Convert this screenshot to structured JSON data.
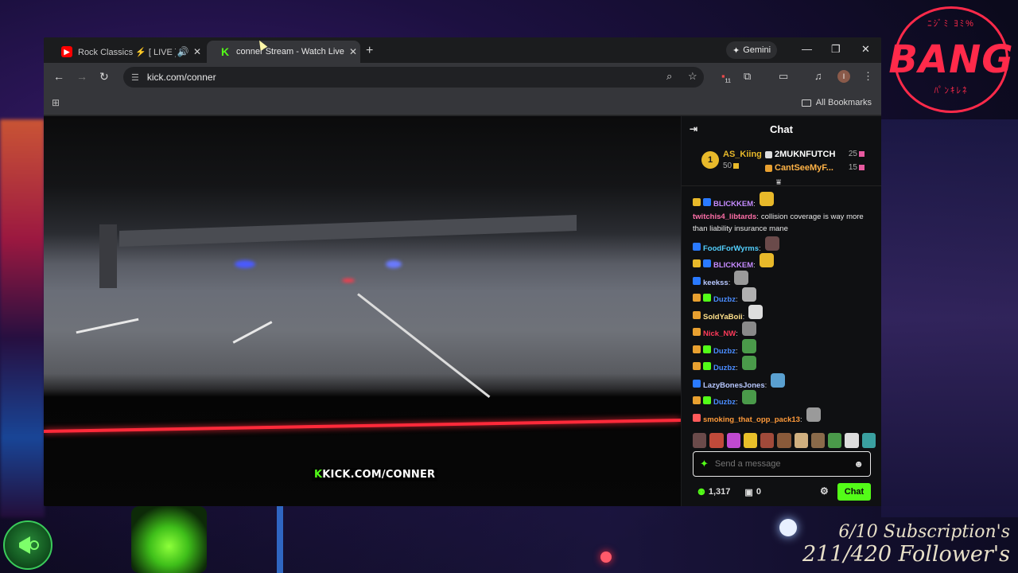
{
  "overlay": {
    "logo_text": "BANG",
    "logo_ring_top": "ﾆｼﾞﾐ ﾖﾐ%",
    "logo_ring_bottom": "ﾊﾟﾝｷﾚﾈ",
    "subscriptions": "6/10 Subscription's",
    "followers": "211/420 Follower's"
  },
  "browser": {
    "tabs": [
      {
        "title": "Rock Classics ⚡ [ LIVE ] Tim",
        "icon": "youtube-icon",
        "active": false
      },
      {
        "title": "conner Stream - Watch Live on",
        "icon": "kick-icon",
        "active": true
      }
    ],
    "gemini_label": "Gemini",
    "url": "kick.com/conner",
    "extensions_badge": "11",
    "profile_initial": "I",
    "all_bookmarks": "All Bookmarks"
  },
  "video": {
    "watermark_k": "K",
    "watermark_text": "KICK.COM/CONNER"
  },
  "chat": {
    "title": "Chat",
    "leaderboard": {
      "rank": "1",
      "top_name": "AS_Kiing",
      "top_count": "50",
      "rows": [
        {
          "name": "2MUKNFUTCH",
          "count": "25",
          "color": "#ffffff"
        },
        {
          "name": "CantSeeMyF...",
          "count": "15",
          "color": "#ffb347"
        }
      ]
    },
    "messages": [
      {
        "user": "BLICKKEM",
        "color": "#c58bff",
        "badges": [
          "crown",
          "verified"
        ],
        "text": "",
        "emote": "#e8b92a"
      },
      {
        "user": "twitchis4_libtards",
        "color": "#ff6fa8",
        "badges": [],
        "text": "collision coverage is way more than liability insurance mane",
        "emote": ""
      },
      {
        "user": "FoodForWyrms",
        "color": "#53d0ff",
        "badges": [
          "verified"
        ],
        "text": "",
        "emote": "#6a4a4a"
      },
      {
        "user": "BLICKKEM",
        "color": "#c58bff",
        "badges": [
          "crown",
          "verified"
        ],
        "text": "",
        "emote": "#e8b92a"
      },
      {
        "user": "keekss",
        "color": "#b8c8ff",
        "badges": [
          "verified"
        ],
        "text": "",
        "emote": "#9a9a9a"
      },
      {
        "user": "Duzbz",
        "color": "#4a8cff",
        "badges": [
          "og",
          "sub"
        ],
        "text": "",
        "emote": "#b0b0b0"
      },
      {
        "user": "SoldYaBoii",
        "color": "#ffe08a",
        "badges": [
          "og"
        ],
        "text": "",
        "emote": "#dddddd"
      },
      {
        "user": "Nick_NW",
        "color": "#ff3a5a",
        "badges": [
          "og"
        ],
        "text": "",
        "emote": "#8a8a8a"
      },
      {
        "user": "Duzbz",
        "color": "#4a8cff",
        "badges": [
          "og",
          "sub"
        ],
        "text": "",
        "emote": "#4a9a4a"
      },
      {
        "user": "Duzbz",
        "color": "#4a8cff",
        "badges": [
          "og",
          "sub"
        ],
        "text": "",
        "emote": "#4a9a4a"
      },
      {
        "user": "LazyBonesJones",
        "color": "#b8c8ff",
        "badges": [
          "verified"
        ],
        "text": "",
        "emote": "#5aa0d0"
      },
      {
        "user": "Duzbz",
        "color": "#4a8cff",
        "badges": [
          "og",
          "sub"
        ],
        "text": "",
        "emote": "#4a9a4a"
      },
      {
        "user": "smoking_that_opp_pack13",
        "color": "#ff9a3a",
        "badges": [
          "mod"
        ],
        "text": "",
        "emote": "#9a9a9a"
      }
    ],
    "emote_bar": [
      "#6a4a4a",
      "#c04a3a",
      "#c04ad0",
      "#e8c02a",
      "#a04a3a",
      "#8a5a3a",
      "#d0b080",
      "#8a6a4a",
      "#4a9a4a",
      "#dddddd",
      "#3aa0a0"
    ],
    "input_placeholder": "Send a message",
    "viewer_count": "1,317",
    "gift_count": "0",
    "send_label": "Chat",
    "accent_color": "#53fc18"
  }
}
